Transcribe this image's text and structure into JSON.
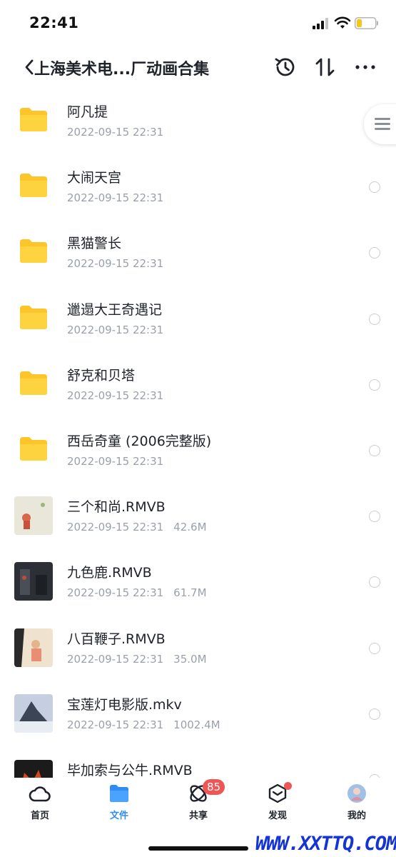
{
  "status_bar": {
    "time": "22:41"
  },
  "header": {
    "title": "上海美术电...厂动画合集"
  },
  "files": [
    {
      "name": "阿凡提",
      "date": "2022-09-15 22:31",
      "size": "",
      "kind": "folder"
    },
    {
      "name": "大闹天宫",
      "date": "2022-09-15 22:31",
      "size": "",
      "kind": "folder"
    },
    {
      "name": "黑猫警长",
      "date": "2022-09-15 22:31",
      "size": "",
      "kind": "folder"
    },
    {
      "name": "邋遢大王奇遇记",
      "date": "2022-09-15 22:31",
      "size": "",
      "kind": "folder"
    },
    {
      "name": "舒克和贝塔",
      "date": "2022-09-15 22:31",
      "size": "",
      "kind": "folder"
    },
    {
      "name": "西岳奇童 (2006完整版)",
      "date": "2022-09-15 22:31",
      "size": "",
      "kind": "folder"
    },
    {
      "name": "三个和尚.RMVB",
      "date": "2022-09-15 22:31",
      "size": "42.6M",
      "kind": "video"
    },
    {
      "name": "九色鹿.RMVB",
      "date": "2022-09-15 22:31",
      "size": "61.7M",
      "kind": "video"
    },
    {
      "name": "八百鞭子.RMVB",
      "date": "2022-09-15 22:31",
      "size": "35.0M",
      "kind": "video"
    },
    {
      "name": "宝莲灯电影版.mkv",
      "date": "2022-09-15 22:31",
      "size": "1002.4M",
      "kind": "video"
    },
    {
      "name": "毕加索与公牛.RMVB",
      "date": "",
      "size": "",
      "kind": "video"
    }
  ],
  "tabs": [
    {
      "label": "首页",
      "icon": "cloud-icon"
    },
    {
      "label": "文件",
      "icon": "folder-icon",
      "active": true
    },
    {
      "label": "共享",
      "icon": "orbit-icon",
      "badge": "85"
    },
    {
      "label": "发现",
      "icon": "cube-icon"
    },
    {
      "label": "我的",
      "icon": "avatar-icon"
    }
  ],
  "watermark": "WWW.XXTTQ.COM",
  "colors": {
    "accent": "#2f8cf7",
    "folder": "#fcc62b",
    "badge": "#f05555",
    "meta_text": "#9aa0ab"
  }
}
